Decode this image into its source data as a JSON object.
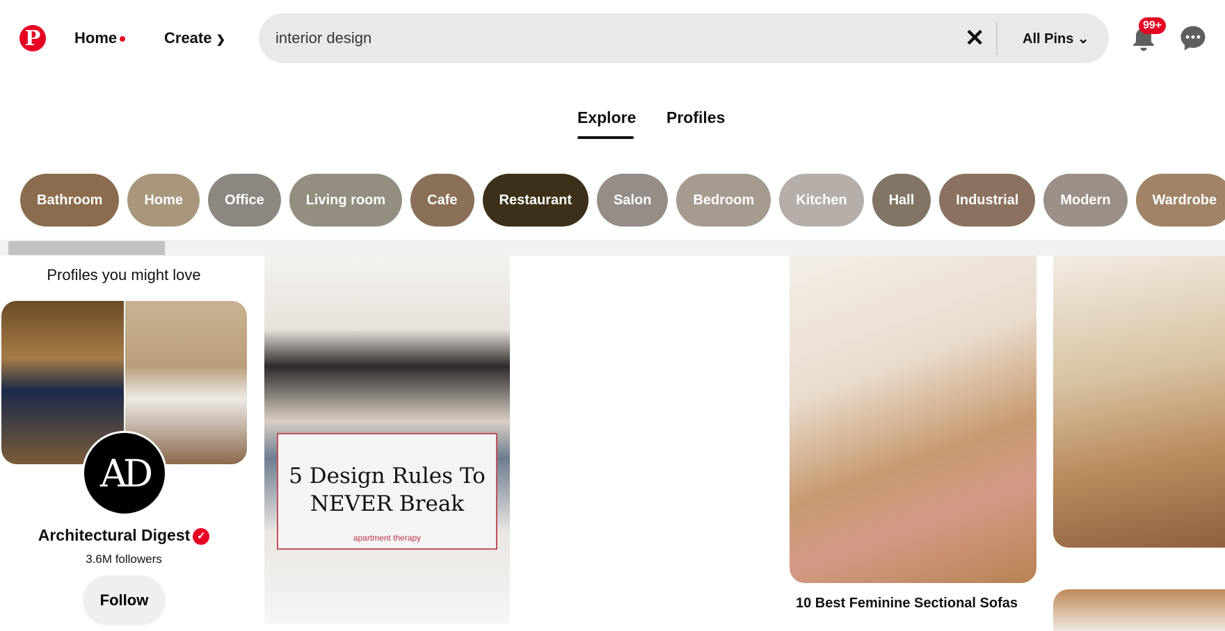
{
  "header": {
    "logo": "P",
    "home_label": "Home",
    "create_label": "Create",
    "search_value": "interior design",
    "search_filter": "All Pins",
    "notification_count": "99+"
  },
  "tabs": [
    {
      "label": "Explore",
      "active": true
    },
    {
      "label": "Profiles",
      "active": false
    }
  ],
  "chips": [
    {
      "label": "Bathroom",
      "color": "#8a6c4e"
    },
    {
      "label": "Home",
      "color": "#a8977c"
    },
    {
      "label": "Office",
      "color": "#8c8880"
    },
    {
      "label": "Living room",
      "color": "#948e80"
    },
    {
      "label": "Cafe",
      "color": "#8a7058"
    },
    {
      "label": "Restaurant",
      "color": "#3c3018"
    },
    {
      "label": "Salon",
      "color": "#958d86"
    },
    {
      "label": "Bedroom",
      "color": "#a59b8f"
    },
    {
      "label": "Kitchen",
      "color": "#b5aea9"
    },
    {
      "label": "Hall",
      "color": "#827565"
    },
    {
      "label": "Industrial",
      "color": "#8b7260"
    },
    {
      "label": "Modern",
      "color": "#9b9088"
    },
    {
      "label": "Wardrobe",
      "color": "#a08468"
    }
  ],
  "profiles": {
    "title": "Profiles you might love",
    "name": "Architectural Digest",
    "avatar_text": "AD",
    "followers": "3.6M followers",
    "follow_label": "Follow"
  },
  "pins": [
    {
      "overlay_title_1": "5 Design Rules To",
      "overlay_title_2": "NEVER Break",
      "brand": "apartment therapy"
    },
    {
      "caption": "10 Best Feminine Sectional Sofas"
    }
  ],
  "colors": {
    "brand": "#e60023"
  }
}
